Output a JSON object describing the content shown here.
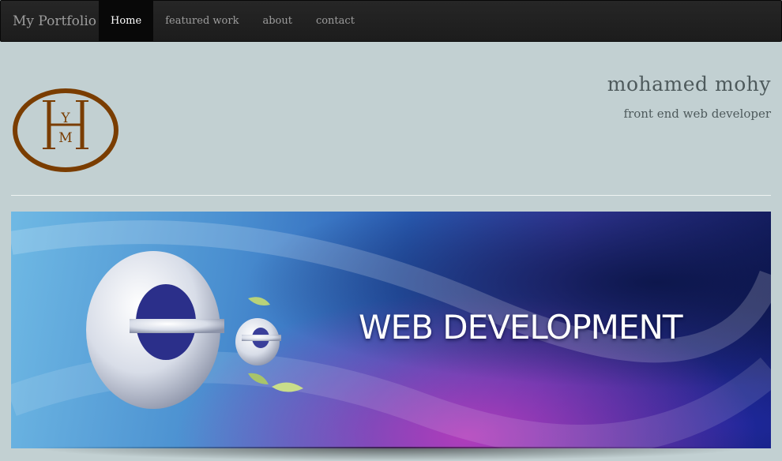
{
  "navbar": {
    "brand": "My Portfolio",
    "items": [
      {
        "label": "Home",
        "active": true
      },
      {
        "label": "featured work",
        "active": false
      },
      {
        "label": "about",
        "active": false
      },
      {
        "label": "contact",
        "active": false
      }
    ]
  },
  "header": {
    "logo_letters": [
      "H",
      "Y",
      "M"
    ],
    "name": "mohamed mohy",
    "tagline": "front end web developer"
  },
  "banner": {
    "text": "WEB DEVELOPMENT",
    "icon": "ie-logo-icon"
  },
  "colors": {
    "background": "#c2d0d2",
    "navbar": "#222222",
    "active_nav": "#080808",
    "logo": "#7a3d00",
    "text": "#4e5a5c"
  }
}
